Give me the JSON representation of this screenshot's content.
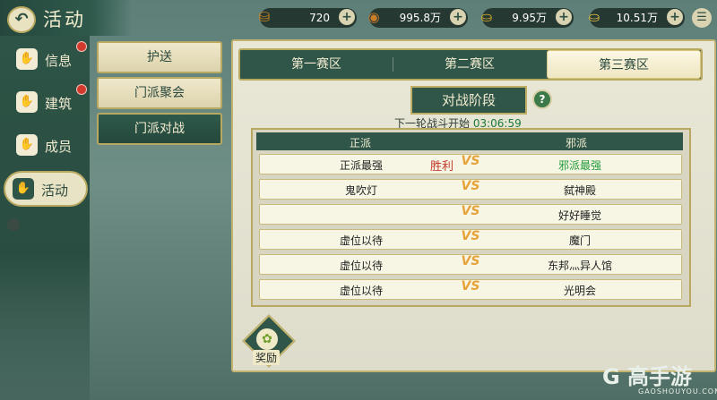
{
  "header": {
    "title": "活动",
    "back_icon": "↶"
  },
  "resources": [
    {
      "icon": "ingot-pile-icon",
      "glyph": "⛁",
      "value": "720",
      "color": "#d38a1e"
    },
    {
      "icon": "coin-icon",
      "glyph": "◉",
      "value": "995.8万",
      "color": "#c97e2a"
    },
    {
      "icon": "gold-ingot-icon",
      "glyph": "⛀",
      "value": "9.95万",
      "color": "#e2b42a"
    },
    {
      "icon": "silver-ingot-icon",
      "glyph": "⛀",
      "value": "10.51万",
      "color": "#e8c24a"
    }
  ],
  "plus": "+",
  "menu_glyph": "☰",
  "leftnav": [
    {
      "label": "信息",
      "glyph": "✋",
      "dot": true
    },
    {
      "label": "建筑",
      "glyph": "✋",
      "dot": true
    },
    {
      "label": "成员",
      "glyph": "✋",
      "dot": false
    },
    {
      "label": "活动",
      "glyph": "✋",
      "dot": false,
      "active": true
    }
  ],
  "submenu": [
    {
      "label": "护送",
      "active": false
    },
    {
      "label": "门派聚会",
      "active": false
    },
    {
      "label": "门派对战",
      "active": true
    }
  ],
  "tabs": [
    {
      "label": "第一赛区",
      "active": false
    },
    {
      "label": "第二赛区",
      "active": false
    },
    {
      "label": "第三赛区",
      "active": true
    }
  ],
  "phase": {
    "title": "对战阶段",
    "help": "?",
    "next_label": "下一轮战斗开始",
    "countdown": "03:06:59"
  },
  "table": {
    "left_header": "正派",
    "right_header": "邪派",
    "vs": "VS",
    "win_label": "胜利",
    "rows": [
      {
        "left": "正派最强",
        "right": "邪派最强",
        "win": true,
        "right_green": true
      },
      {
        "left": "鬼吹灯",
        "right": "弑神殿"
      },
      {
        "left": "",
        "right": "好好睡觉"
      },
      {
        "left": "虚位以待",
        "right": "魔门"
      },
      {
        "left": "虚位以待",
        "right": "东邦灬异人馆"
      },
      {
        "left": "虚位以待",
        "right": "光明会"
      }
    ]
  },
  "reward": {
    "label": "奖励",
    "glyph": "✿"
  },
  "watermark": {
    "brand": "G 高手游",
    "url": "GAOSHOUYOU.COM"
  }
}
